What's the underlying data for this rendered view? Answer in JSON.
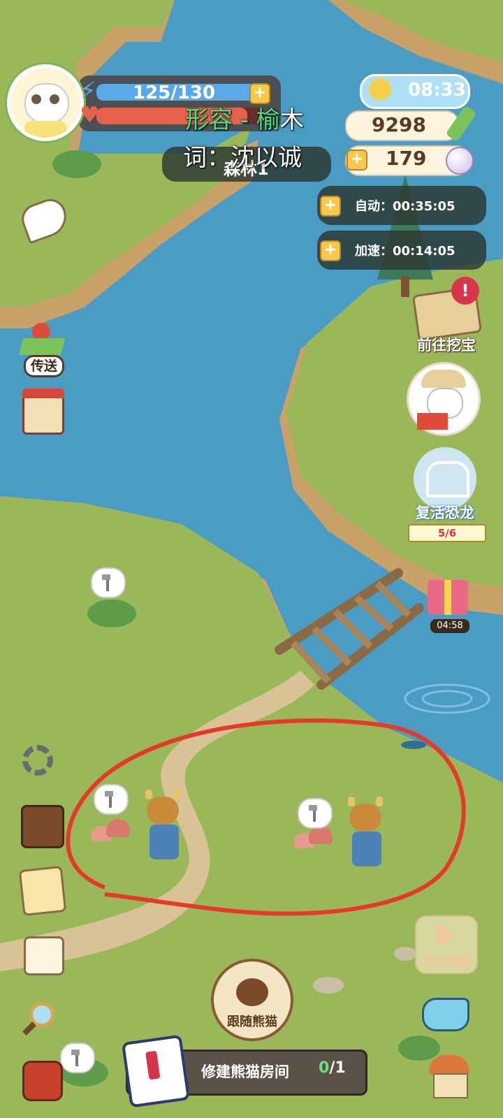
{
  "hud": {
    "energy": "125/130",
    "time": "08:33",
    "coins": "9298",
    "pearls": "179",
    "auto_label": "自动：",
    "auto_time": "00:35:05",
    "speed_label": "加速：",
    "speed_time": "00:14:05",
    "area_name": "森林1",
    "energy_fraction": 0.96,
    "health_fraction": 0.9
  },
  "lyrics": {
    "line1_colored": "形容 - 榆",
    "line1_rest": "木",
    "line2": "词：沈以诚"
  },
  "side_right": {
    "treasure_label": "前往挖宝",
    "dino_label": "复活恐龙",
    "dino_progress": "5/6",
    "gift_timer": "04:58",
    "auto_collect": "自动采集"
  },
  "side_left": {
    "teleport_label": "传送"
  },
  "bottom": {
    "follow_label": "跟随熊猫",
    "quest_label": "修建熊猫房间",
    "quest_done": "0",
    "quest_total": "/1"
  },
  "colors": {
    "grass": "#9ab85a",
    "river": "#4a9cc4",
    "energy": "#5aa9e6",
    "health": "#e8614a",
    "annotation": "#e53a2a"
  }
}
